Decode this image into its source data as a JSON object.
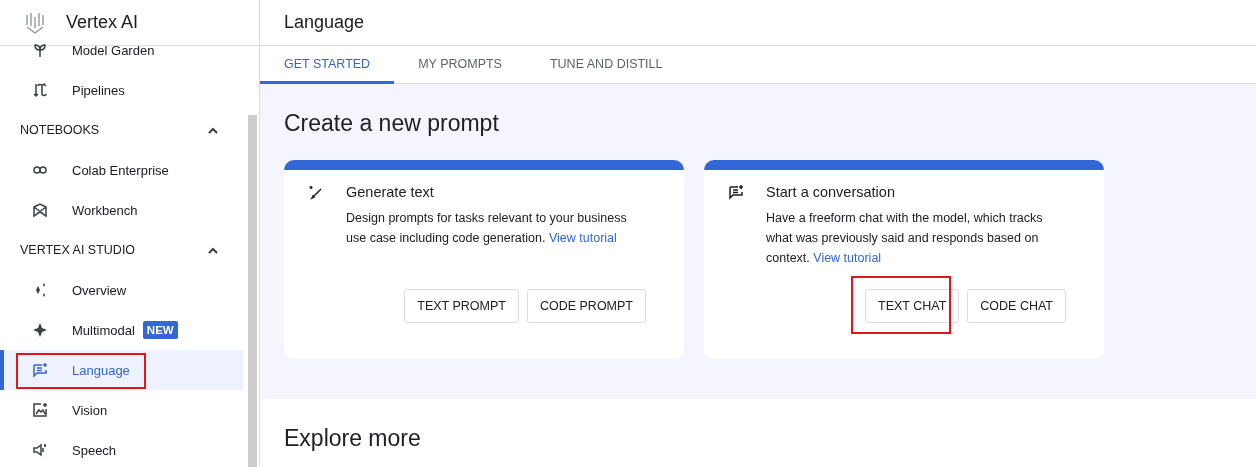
{
  "app": {
    "title": "Vertex AI"
  },
  "nav": [
    {
      "kind": "item",
      "label": "Model Garden",
      "selected": false,
      "highlighted": false
    },
    {
      "kind": "item",
      "label": "Pipelines",
      "selected": false,
      "highlighted": false
    },
    {
      "kind": "section",
      "label": "NOTEBOOKS",
      "expanded": true
    },
    {
      "kind": "item",
      "label": "Colab Enterprise",
      "selected": false,
      "highlighted": false
    },
    {
      "kind": "item",
      "label": "Workbench",
      "selected": false,
      "highlighted": false
    },
    {
      "kind": "section",
      "label": "VERTEX AI STUDIO",
      "expanded": true
    },
    {
      "kind": "item",
      "label": "Overview",
      "selected": false,
      "highlighted": false
    },
    {
      "kind": "item",
      "label": "Multimodal",
      "badge": "NEW",
      "selected": false,
      "highlighted": false
    },
    {
      "kind": "item",
      "label": "Language",
      "selected": true,
      "highlighted": true
    },
    {
      "kind": "item",
      "label": "Vision",
      "selected": false,
      "highlighted": false
    },
    {
      "kind": "item",
      "label": "Speech",
      "selected": false,
      "highlighted": false
    }
  ],
  "page": {
    "title": "Language"
  },
  "tabs": [
    {
      "label": "GET STARTED",
      "selected": true
    },
    {
      "label": "MY PROMPTS",
      "selected": false
    },
    {
      "label": "TUNE AND DISTILL",
      "selected": false
    }
  ],
  "create": {
    "heading": "Create a new prompt",
    "cards": [
      {
        "title": "Generate text",
        "description": "Design prompts for tasks relevant to your business use case including code generation.",
        "link": "View tutorial",
        "buttons": [
          {
            "label": "TEXT PROMPT",
            "highlighted": false
          },
          {
            "label": "CODE PROMPT",
            "highlighted": false
          }
        ]
      },
      {
        "title": "Start a conversation",
        "description": "Have a freeform chat with the model, which tracks what was previously said and responds based on context.",
        "link": "View tutorial",
        "buttons": [
          {
            "label": "TEXT CHAT",
            "highlighted": true
          },
          {
            "label": "CODE CHAT",
            "highlighted": false
          }
        ]
      }
    ]
  },
  "explore": {
    "heading": "Explore more"
  }
}
